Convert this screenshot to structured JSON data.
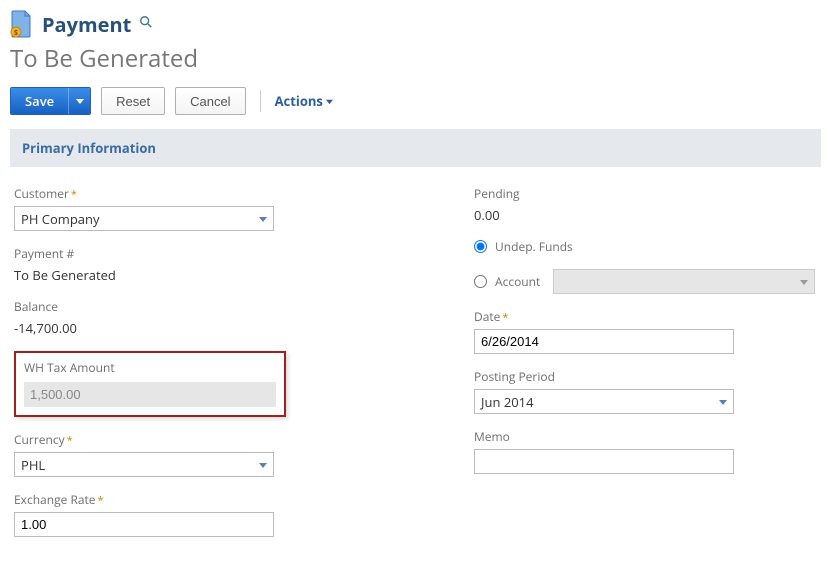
{
  "header": {
    "title": "Payment",
    "subtitle": "To Be Generated"
  },
  "buttons": {
    "save": "Save",
    "reset": "Reset",
    "cancel": "Cancel",
    "actions": "Actions"
  },
  "section": {
    "primary": "Primary Information"
  },
  "left": {
    "customer_label": "Customer",
    "customer_value": "PH Company",
    "payment_num_label": "Payment #",
    "payment_num_value": "To Be Generated",
    "balance_label": "Balance",
    "balance_value": "-14,700.00",
    "whtax_label": "WH Tax Amount",
    "whtax_value": "1,500.00",
    "currency_label": "Currency",
    "currency_value": "PHL",
    "exchange_label": "Exchange Rate",
    "exchange_value": "1.00"
  },
  "right": {
    "pending_label": "Pending",
    "pending_value": "0.00",
    "undep_label": "Undep. Funds",
    "account_label": "Account",
    "account_value": "",
    "date_label": "Date",
    "date_value": "6/26/2014",
    "posting_label": "Posting Period",
    "posting_value": "Jun 2014",
    "memo_label": "Memo",
    "memo_value": ""
  }
}
